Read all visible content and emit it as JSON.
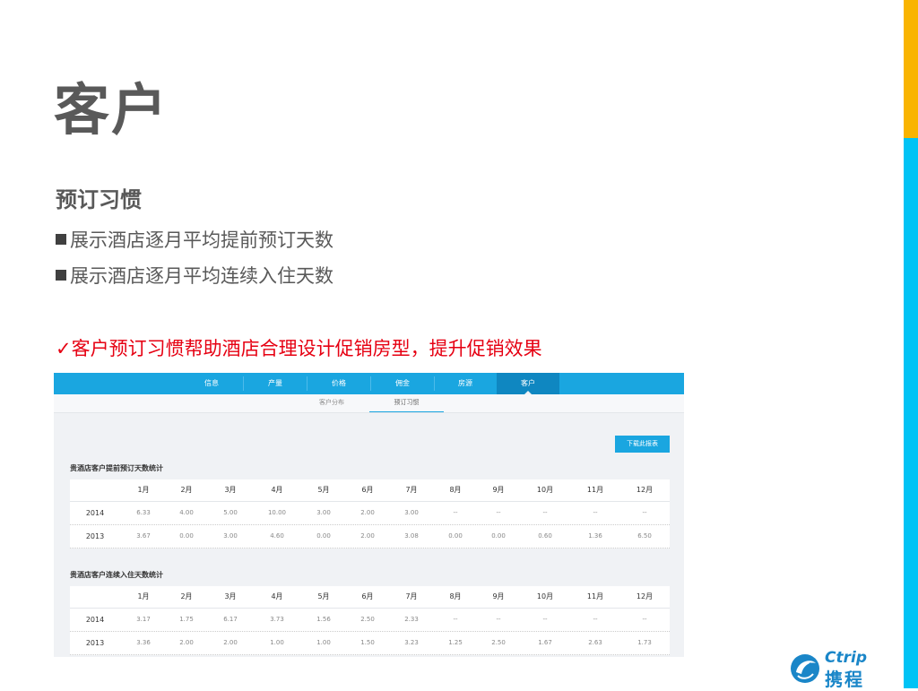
{
  "slide": {
    "title": "客户",
    "subtitle": "预订习惯",
    "bullets": [
      "展示酒店逐月平均提前预订天数",
      "展示酒店逐月平均连续入住天数"
    ],
    "highlight": "✓客户预订习惯帮助酒店合理设计促销房型，提升促销效果"
  },
  "colors": {
    "accent_top": "#f9b400",
    "accent_bottom": "#00c3f5",
    "nav": "#1aa6e0",
    "highlight": "#e60012"
  },
  "screenshot": {
    "nav_tabs": [
      {
        "label": "信息"
      },
      {
        "label": "产量"
      },
      {
        "label": "价格"
      },
      {
        "label": "佣金"
      },
      {
        "label": "房源"
      },
      {
        "label": "客户"
      }
    ],
    "active_tab": "客户",
    "sub_tabs": [
      {
        "label": "客户分布"
      },
      {
        "label": "预订习惯"
      }
    ],
    "active_sub_tab": "预订习惯",
    "download_button": "下载此报表",
    "table1": {
      "title": "贵酒店客户提前预订天数统计",
      "months": [
        "1月",
        "2月",
        "3月",
        "4月",
        "5月",
        "6月",
        "7月",
        "8月",
        "9月",
        "10月",
        "11月",
        "12月"
      ],
      "rows": [
        {
          "year": "2014",
          "values": [
            "6.33",
            "4.00",
            "5.00",
            "10.00",
            "3.00",
            "2.00",
            "3.00",
            "--",
            "--",
            "--",
            "--",
            "--"
          ]
        },
        {
          "year": "2013",
          "values": [
            "3.67",
            "0.00",
            "3.00",
            "4.60",
            "0.00",
            "2.00",
            "3.08",
            "0.00",
            "0.00",
            "0.60",
            "1.36",
            "6.50"
          ]
        }
      ]
    },
    "table2": {
      "title": "贵酒店客户连续入住天数统计",
      "months": [
        "1月",
        "2月",
        "3月",
        "4月",
        "5月",
        "6月",
        "7月",
        "8月",
        "9月",
        "10月",
        "11月",
        "12月"
      ],
      "rows": [
        {
          "year": "2014",
          "values": [
            "3.17",
            "1.75",
            "6.17",
            "3.73",
            "1.56",
            "2.50",
            "2.33",
            "--",
            "--",
            "--",
            "--",
            "--"
          ]
        },
        {
          "year": "2013",
          "values": [
            "3.36",
            "2.00",
            "2.00",
            "1.00",
            "1.00",
            "1.50",
            "3.23",
            "1.25",
            "2.50",
            "1.67",
            "2.63",
            "1.73"
          ]
        }
      ]
    }
  },
  "logo": {
    "en": "Ctrip",
    "cn": "携程",
    "icon": "dolphin-icon"
  }
}
